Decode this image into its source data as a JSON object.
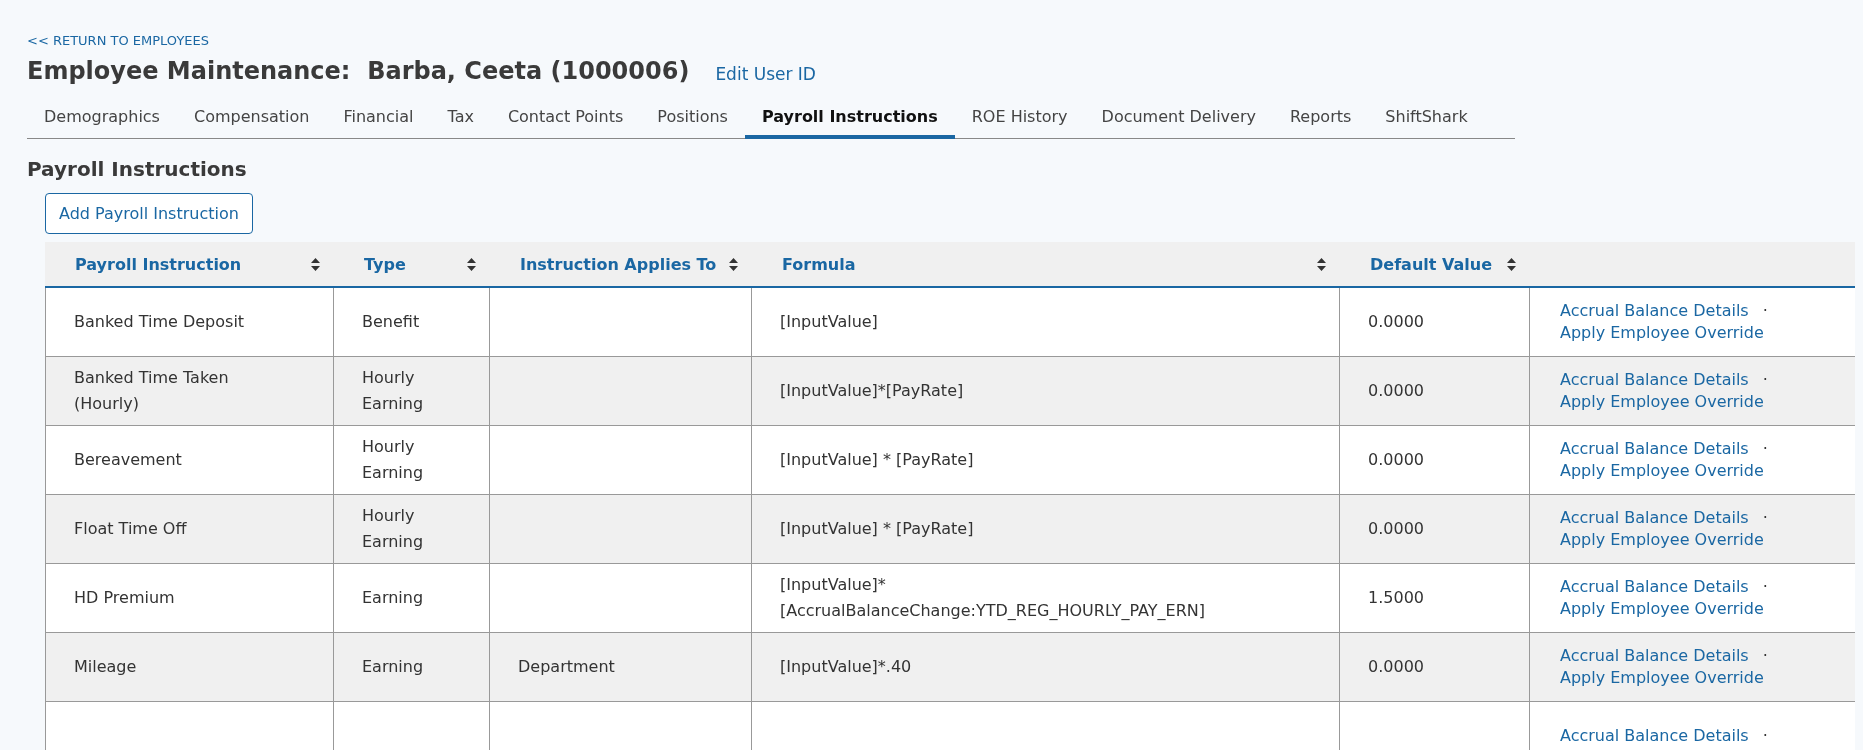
{
  "back_link": "<< RETURN TO EMPLOYEES",
  "page_title": "Employee Maintenance:  Barba, Ceeta (1000006)",
  "edit_link": "Edit User ID",
  "tabs": [
    {
      "label": "Demographics",
      "selected": false
    },
    {
      "label": "Compensation",
      "selected": false
    },
    {
      "label": "Financial",
      "selected": false
    },
    {
      "label": "Tax",
      "selected": false
    },
    {
      "label": "Contact Points",
      "selected": false
    },
    {
      "label": "Positions",
      "selected": false
    },
    {
      "label": "Payroll Instructions",
      "selected": true
    },
    {
      "label": "ROE History",
      "selected": false
    },
    {
      "label": "Document Delivery",
      "selected": false
    },
    {
      "label": "Reports",
      "selected": false
    },
    {
      "label": "ShiftShark",
      "selected": false
    }
  ],
  "section_title": "Payroll Instructions",
  "add_button": "Add Payroll Instruction",
  "table": {
    "columns": [
      "Payroll Instruction",
      "Type",
      "Instruction Applies To",
      "Formula",
      "Default Value"
    ],
    "rows": [
      {
        "cells": [
          "Banked Time Deposit",
          "Benefit",
          "",
          "[InputValue]",
          "0.0000"
        ],
        "actions": [
          "Accrual Balance Details",
          "·",
          "Apply Employee Override"
        ]
      },
      {
        "cells": [
          "Banked Time Taken (Hourly)",
          "Hourly Earning",
          "",
          "[InputValue]*[PayRate]",
          "0.0000"
        ],
        "actions": [
          "Accrual Balance Details",
          "·",
          "Apply Employee Override"
        ]
      },
      {
        "cells": [
          "Bereavement",
          "Hourly Earning",
          "",
          "[InputValue] * [PayRate]",
          "0.0000"
        ],
        "actions": [
          "Accrual Balance Details",
          "·",
          "Apply Employee Override"
        ]
      },
      {
        "cells": [
          "Float Time Off",
          "Hourly Earning",
          "",
          "[InputValue] * [PayRate]",
          "0.0000"
        ],
        "actions": [
          "Accrual Balance Details",
          "·",
          "Apply Employee Override"
        ]
      },
      {
        "cells": [
          "HD Premium",
          "Earning",
          "",
          "[InputValue]* [AccrualBalanceChange:YTD_REG_HOURLY_PAY_ERN]",
          "1.5000"
        ],
        "actions": [
          "Accrual Balance Details",
          "·",
          "Apply Employee Override"
        ]
      },
      {
        "cells": [
          "Mileage",
          "Earning",
          "Department",
          "[InputValue]*.40",
          "0.0000"
        ],
        "actions": [
          "Accrual Balance Details",
          "·",
          "Apply Employee Override"
        ]
      },
      {
        "cells": [
          "",
          "",
          "",
          "",
          ""
        ],
        "actions": [
          "Accrual Balance Details",
          "·"
        ]
      }
    ]
  }
}
